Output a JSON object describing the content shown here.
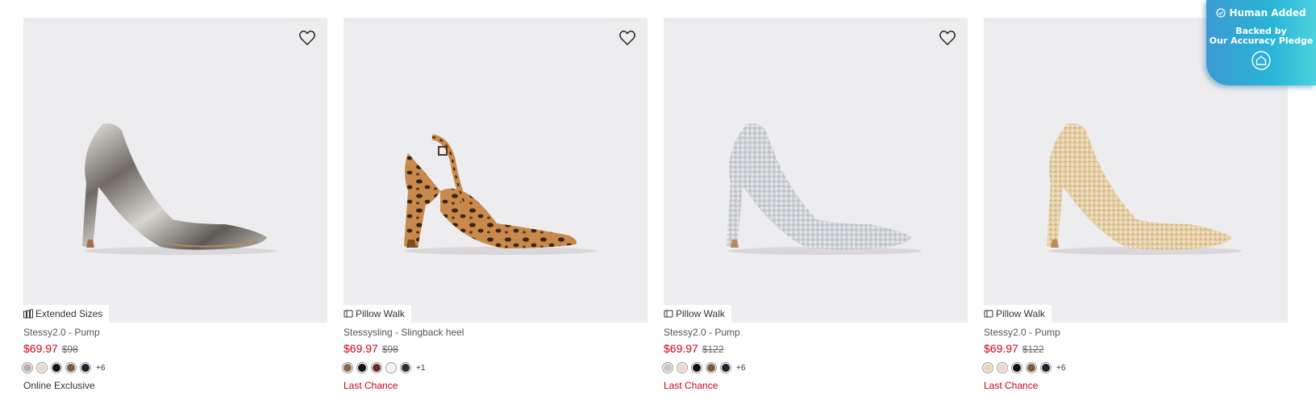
{
  "products": [
    {
      "name": "Stessy2.0 - Pump",
      "badge": "Extended Sizes",
      "badge_icon": "extended-sizes-icon",
      "sale_price": "$69.97",
      "original_price": "$98",
      "swatches": [
        "#b8b0a6",
        "#ecd6c6",
        "#111111",
        "#7a5a44",
        "#1c2430"
      ],
      "more_colors": "+6",
      "tag": "Online Exclusive",
      "tag_type": "online",
      "material": "metallic-pewter"
    },
    {
      "name": "Stessysling - Slingback heel",
      "badge": "Pillow Walk",
      "badge_icon": "pillow-walk-icon",
      "sale_price": "$69.97",
      "original_price": "$98",
      "swatches": [
        "#8a6a4a",
        "#111111",
        "#6a2a2a",
        "#f4f2ee",
        "#2a2f38"
      ],
      "more_colors": "+1",
      "tag": "Last Chance",
      "tag_type": "last",
      "material": "leopard"
    },
    {
      "name": "Stessy2.0 - Pump",
      "badge": "Pillow Walk",
      "badge_icon": "pillow-walk-icon",
      "sale_price": "$69.97",
      "original_price": "$122",
      "swatches": [
        "#c8c8c8",
        "#ecd6c6",
        "#111111",
        "#7a5a44",
        "#1c2430"
      ],
      "more_colors": "+6",
      "tag": "Last Chance",
      "tag_type": "last",
      "material": "silver-glitter"
    },
    {
      "name": "Stessy2.0 - Pump",
      "badge": "Pillow Walk",
      "badge_icon": "pillow-walk-icon",
      "sale_price": "$69.97",
      "original_price": "$122",
      "swatches": [
        "#e8d6b4",
        "#ecd6c6",
        "#111111",
        "#7a5a44",
        "#1c2430"
      ],
      "more_colors": "+6",
      "tag": "Last Chance",
      "tag_type": "last",
      "material": "gold-glitter"
    }
  ],
  "pledge": {
    "title": "Human Added",
    "line1": "Backed by",
    "line2": "Our Accuracy Pledge",
    "icon": "home-icon"
  },
  "colors": {
    "sale": "#d0021b",
    "image_bg": "#edecee",
    "pledge_gradient": [
      "#3c9ad2",
      "#4cd1de"
    ]
  }
}
